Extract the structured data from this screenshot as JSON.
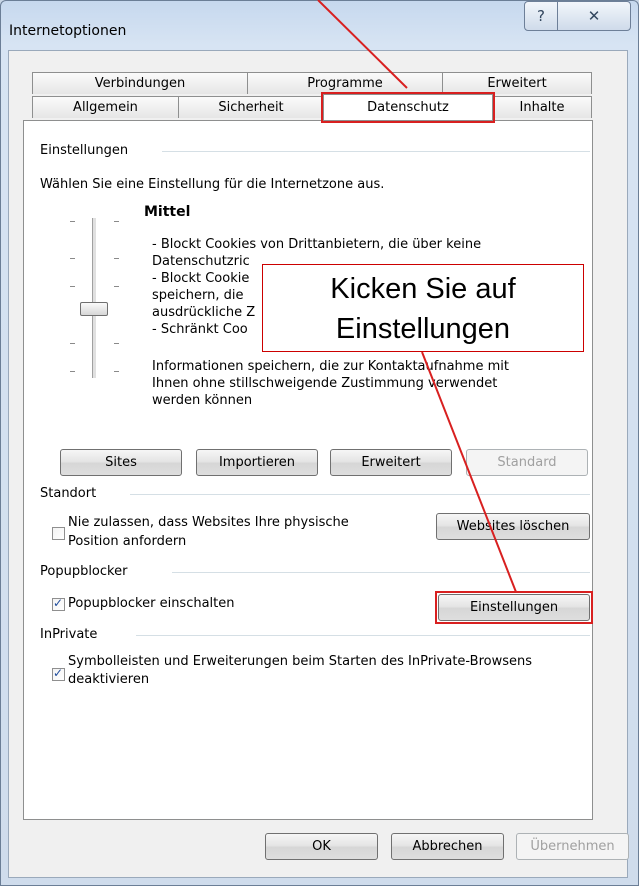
{
  "window": {
    "title": "Internetoptionen",
    "help_glyph": "?",
    "close_glyph": "✕"
  },
  "tabs": {
    "row_back": [
      "Verbindungen",
      "Programme",
      "Erweitert"
    ],
    "row_front": [
      "Allgemein",
      "Sicherheit",
      "Datenschutz",
      "Inhalte"
    ],
    "active": "Datenschutz"
  },
  "settings": {
    "heading": "Einstellungen",
    "instruction": "Wählen Sie eine Einstellung für die Internetzone aus.",
    "level_title": "Mittel",
    "description_lines": [
      "- Blockt Cookies von Drittanbietern, die über keine",
      "Datenschutzric",
      "- Blockt Cookie",
      "speichern, die",
      "ausdrückliche Z",
      "- Schränkt Coo",
      "Informationen speichern, die zur Kontaktaufnahme mit",
      "Ihnen ohne stillschweigende Zustimmung verwendet",
      "werden können"
    ],
    "buttons": {
      "sites": "Sites",
      "import": "Importieren",
      "advanced": "Erweitert",
      "default": "Standard"
    }
  },
  "location": {
    "heading": "Standort",
    "checkbox_label_line1": "Nie zulassen, dass Websites Ihre physische",
    "checkbox_label_line2": "Position anfordern",
    "checked": false,
    "clear_button": "Websites löschen"
  },
  "popup": {
    "heading": "Popupblocker",
    "checkbox_label": "Popupblocker einschalten",
    "checked": true,
    "settings_button": "Einstellungen"
  },
  "inprivate": {
    "heading": "InPrivate",
    "checkbox_label_line1": "Symbolleisten und Erweiterungen beim Starten des InPrivate-Browsens",
    "checkbox_label_line2": "deaktivieren",
    "checked": true
  },
  "footer": {
    "ok": "OK",
    "cancel": "Abbrechen",
    "apply": "Übernehmen"
  },
  "annotation": {
    "callout_line1": "Kicken Sie auf",
    "callout_line2": "Einstellungen",
    "color": "#d82020"
  }
}
